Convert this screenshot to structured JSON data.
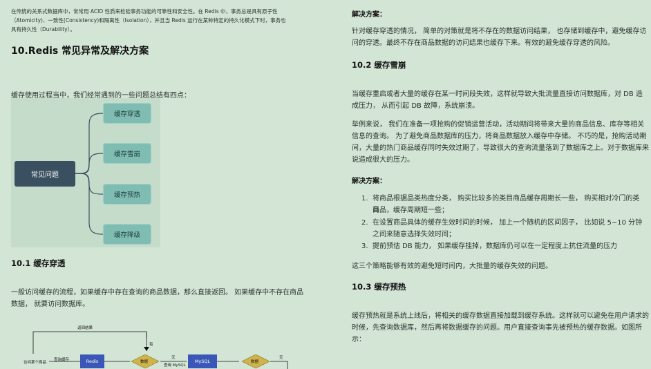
{
  "left": {
    "intro_line1": "在传统的关系式数据库中，常常用 ACID 性质来检验事务功能的可靠性和安全性。在 Redis 中，事务总是具有原子性",
    "intro_line2": "（Atomicity)、一致性(Consistency)和隔离性（Isolation），并且当 Redis 运行在某种特定的持久化模式下时，事务也",
    "intro_line3": "具有持久性（Durability）。",
    "h_section": "10.Redis 常见异常及解决方案",
    "summary": "缓存使用过程当中，我们经常遇到的一些问题总结有四点：",
    "mind_root": "常见问题",
    "mind_nodes": [
      "缓存穿透",
      "缓存雪崩",
      "缓存预热",
      "缓存降级"
    ],
    "h_101": "10.1 缓存穿透",
    "p101_line1": "一般访问缓存的流程，如果缓存中存在查询的商品数据，那么直接返回。 如果缓存中不存在商品",
    "p101_line2": "数据， 就要访问数据库。",
    "flow": {
      "return_result": "返回结果",
      "yes": "有",
      "access_goods": "访问某个商品",
      "query_cache": "查询缓存",
      "redis": "Redis",
      "data1": "数据",
      "none1": "无",
      "query_mysql": "查询 MySQL",
      "mysql": "MySQL",
      "data2": "数据",
      "none2": "无"
    }
  },
  "right": {
    "solution_label1": "解决方案：",
    "sol1_line1": "针对缓存穿透的情况， 简单的对策就是将不存在的数据访问结果， 也存储到缓存中，避免缓存访",
    "sol1_line2": "问的穿透。最终不存在商品数据的访问结果也缓存下来。有效的避免缓存穿透的风险。",
    "h_102": "10.2 缓存雪崩",
    "p102_line1": "当缓存重启或者大量的缓存在某一时间段失效，这样就导致大批流量直接访问数据库，对 DB 造",
    "p102_line2": "成压力， 从而引起 DB 故障，系统崩溃。",
    "ex_line1": "举例来说， 我们在准备一项抢购的促销运营活动，活动期间将带来大量的商品信息、库存等相关",
    "ex_line2": "信息的查询。 为了避免商品数据库的压力，将商品数据放入缓存中存储。 不巧的是，抢购活动期",
    "ex_line3": "间，大量的热门商品缓存同时失效过期了，导致很大的查询流量落到了数据库之上。对于数据库来",
    "ex_line4": "说造成很大的压力。",
    "solution_label2": "解决方案：",
    "items": [
      {
        "num": "1.",
        "line1": "将商品根据品类热度分类， 购买比较多的类目商品缓存周期长一些， 购买相对冷门的类目",
        "line2": "商品，缓存周期短一些；"
      },
      {
        "num": "2.",
        "line1": "在设置商品具体的缓存生效时间的时候， 加上一个随机的区间因子， 比如说 5~10 分钟",
        "line2": "之间来随意选择失效时间；"
      },
      {
        "num": "3.",
        "line1": "提前预估 DB 能力， 如果缓存挂掉，数据库仍可以在一定程度上抗住流量的压力",
        "line2": ""
      }
    ],
    "conclusion": "这三个策略能够有效的避免短时间内，大批量的缓存失效的问题。",
    "h_103": "10.3 缓存预热",
    "p103_line1": "缓存预热就是系统上线后，将相关的缓存数据直接加载到缓存系统。这样就可以避免在用户请求的",
    "p103_line2": "时候，先查询数据库，然后再将数据缓存的问题。用户直接查询事先被预热的缓存数据。如图所示："
  }
}
